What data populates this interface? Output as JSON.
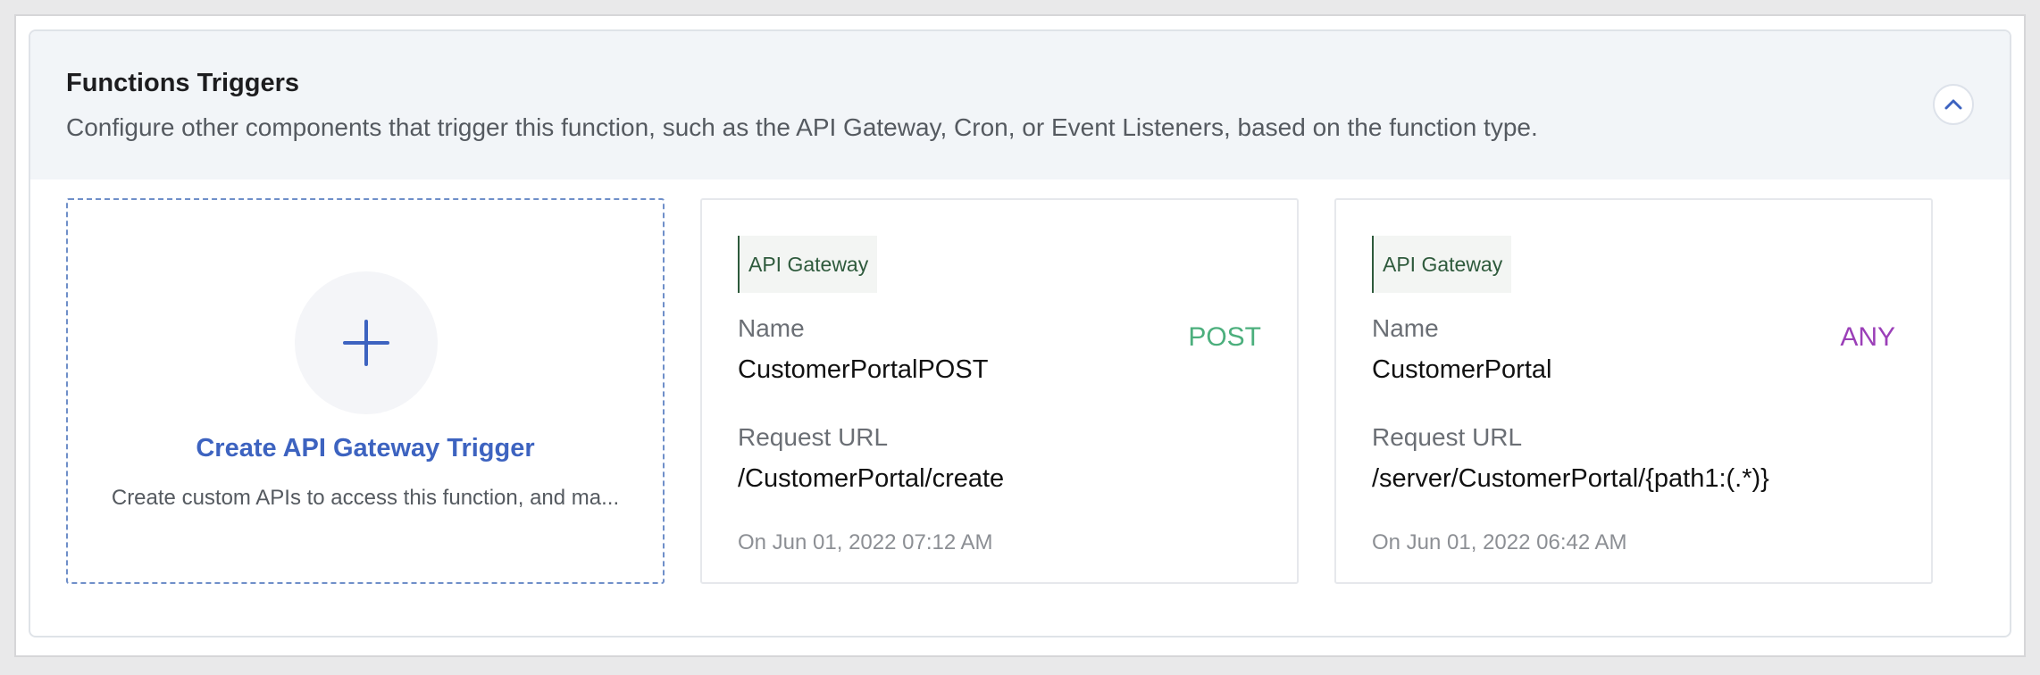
{
  "section": {
    "title": "Functions Triggers",
    "description": "Configure other components that trigger this function, such as the API Gateway, Cron, or Event Listeners, based on the function type."
  },
  "create_card": {
    "title": "Create API Gateway Trigger",
    "description": "Create custom APIs to access this function, and ma..."
  },
  "triggers": [
    {
      "tag": "API Gateway",
      "name_label": "Name",
      "name": "CustomerPortalPOST",
      "method": "POST",
      "method_color": "#4caf7d",
      "url_label": "Request URL",
      "url": "/CustomerPortal/create",
      "timestamp": "On Jun 01, 2022 07:12 AM"
    },
    {
      "tag": "API Gateway",
      "name_label": "Name",
      "name": "CustomerPortal",
      "method": "ANY",
      "method_color": "#9b3fb8",
      "url_label": "Request URL",
      "url": "/server/CustomerPortal/{path1:(.*)}",
      "timestamp": "On Jun 01, 2022 06:42 AM"
    }
  ],
  "colors": {
    "accent": "#3d63c0",
    "header_bg": "#f2f5f8",
    "tag_text": "#2e5a3c"
  },
  "icons": {
    "collapse": "chevron-up-icon",
    "add": "plus-icon"
  }
}
